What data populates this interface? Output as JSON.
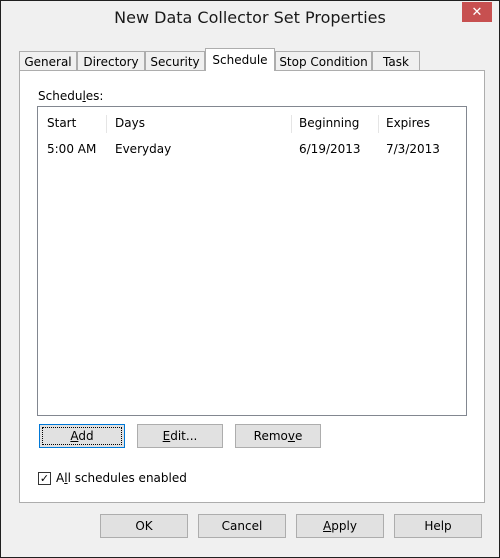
{
  "window": {
    "title": "New Data Collector Set Properties",
    "close_glyph": "✕"
  },
  "tabs": [
    {
      "label": "General"
    },
    {
      "label": "Directory"
    },
    {
      "label": "Security"
    },
    {
      "label": "Schedule",
      "selected": true
    },
    {
      "label": "Stop Condition"
    },
    {
      "label": "Task"
    }
  ],
  "schedule": {
    "label_pre": "Schedu",
    "label_u": "l",
    "label_post": "es:",
    "columns": [
      "Start",
      "Days",
      "Beginning",
      "Expires"
    ],
    "rows": [
      [
        "5:00 AM",
        "Everyday",
        "6/19/2013",
        "7/3/2013"
      ]
    ],
    "add_u": "A",
    "add_rest": "dd",
    "edit_u": "E",
    "edit_rest": "dit...",
    "remove_pre": "Remo",
    "remove_u": "v",
    "remove_post": "e",
    "checkbox_checked": true,
    "checkbox_mark": "✓",
    "checkbox_label_pre": "A",
    "checkbox_label_u": "l",
    "checkbox_label_post": "l schedules enabled"
  },
  "footer": {
    "ok": "OK",
    "cancel": "Cancel",
    "apply_u": "A",
    "apply_rest": "pply",
    "help": "Help"
  },
  "colors": {
    "close_button": "#c75050",
    "focus_border": "#0078d7"
  }
}
